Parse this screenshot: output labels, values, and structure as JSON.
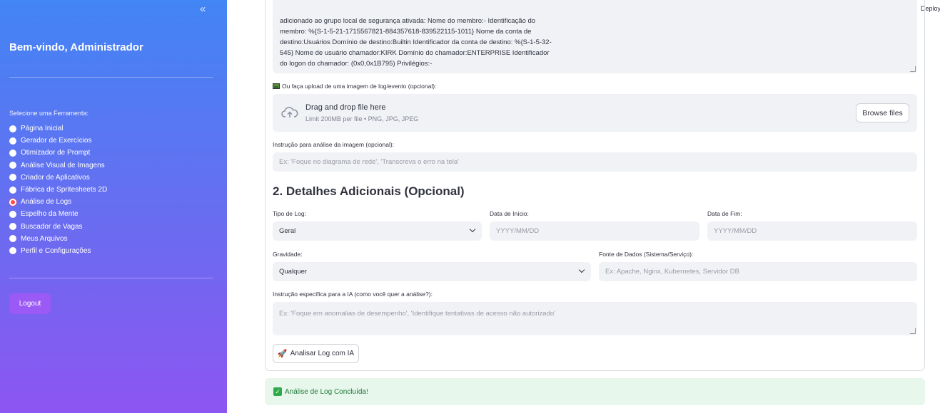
{
  "sidebar": {
    "collapse_icon": "«",
    "welcome": "Bem-vindo, Administrador",
    "tool_label": "Selecione uma Ferramenta:",
    "items": [
      {
        "label": "Página Inicial",
        "selected": false
      },
      {
        "label": "Gerador de Exercícios",
        "selected": false
      },
      {
        "label": "Otimizador de Prompt",
        "selected": false
      },
      {
        "label": "Análise Visual de Imagens",
        "selected": false
      },
      {
        "label": "Criador de Aplicativos",
        "selected": false
      },
      {
        "label": "Fábrica de Spritesheets 2D",
        "selected": false
      },
      {
        "label": "Análise de Logs",
        "selected": true
      },
      {
        "label": "Espelho da Mente",
        "selected": false
      },
      {
        "label": "Buscador de Vagas",
        "selected": false
      },
      {
        "label": "Meus Arquivos",
        "selected": false
      },
      {
        "label": "Perfil e Configurações",
        "selected": false
      }
    ],
    "logout": "Logout"
  },
  "topbar": {
    "deploy": "Deploy"
  },
  "log_text": {
    "lines": [
      "adicionado ao grupo local de segurança ativada: Nome do membro:- Identificação do",
      "membro: %{S-1-5-21-1715567821-884357618-839522115-1011} Nome da conta de",
      "destino:Usuários Domínio de destino:Builtin Identificador da conta de destino: %{S-1-5-32-",
      "545} Nome de usuário chamador:KIRK Domínio do chamador:ENTERPRISE Identificador",
      "do logon do chamador: (0x0,0x1B795) Privilégios:-"
    ]
  },
  "upload": {
    "label": "Ou faça upload de uma imagem de log/evento (opcional):",
    "drag_title": "Drag and drop file here",
    "limit": "Limit 200MB per file • PNG, JPG, JPEG",
    "browse": "Browse files"
  },
  "image_instruction": {
    "label": "Instrução para análise da imagem (opcional):",
    "placeholder": "Ex: 'Foque no diagrama de rede', 'Transcreva o erro na tela'"
  },
  "details": {
    "title": "2. Detalhes Adicionais (Opcional)",
    "log_type": {
      "label": "Tipo de Log:",
      "value": "Geral"
    },
    "start_date": {
      "label": "Data de Início:",
      "placeholder": "YYYY/MM/DD"
    },
    "end_date": {
      "label": "Data de Fim:",
      "placeholder": "YYYY/MM/DD"
    },
    "severity": {
      "label": "Gravidade:",
      "value": "Qualquer"
    },
    "source": {
      "label": "Fonte de Dados (Sistema/Serviço):",
      "placeholder": "Ex: Apache, Nginx, Kubernetes, Servidor DB"
    },
    "ai_instruction": {
      "label": "Instrução específica para a IA (como você quer a análise?):",
      "placeholder": "Ex: 'Foque em anomalias de desempenho', 'Identifique tentativas de acesso não autorizado'"
    }
  },
  "analyze_button": "Analisar Log com IA",
  "success": "Análise de Log Concluída!"
}
